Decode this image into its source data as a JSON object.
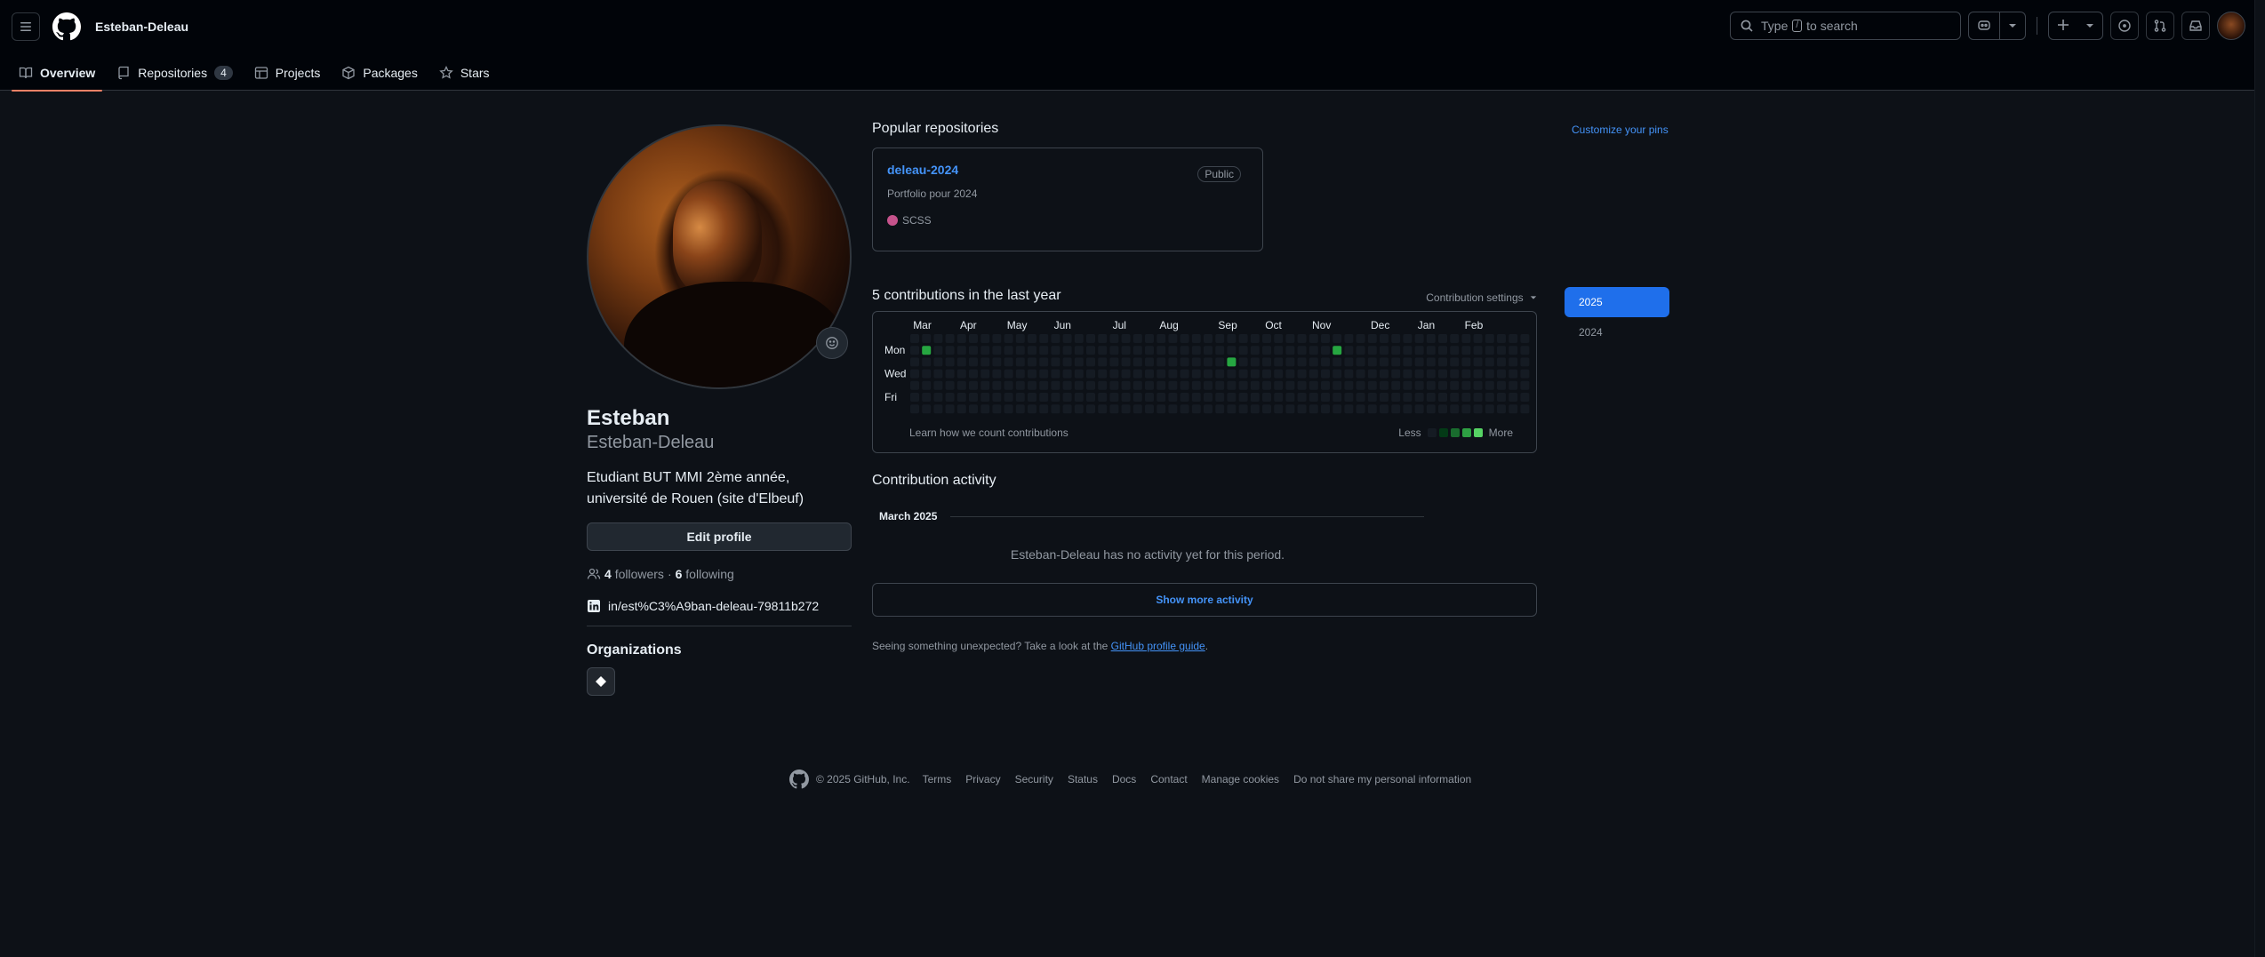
{
  "header": {
    "owner": "Esteban-Deleau",
    "search_prefix": "Type",
    "search_key": "/",
    "search_suffix": "to search"
  },
  "tabs": [
    {
      "label": "Overview",
      "count": ""
    },
    {
      "label": "Repositories",
      "count": "4"
    },
    {
      "label": "Projects",
      "count": ""
    },
    {
      "label": "Packages",
      "count": ""
    },
    {
      "label": "Stars",
      "count": ""
    }
  ],
  "profile": {
    "name": "Esteban",
    "login": "Esteban-Deleau",
    "bio": "Etudiant BUT MMI 2ème année, université de Rouen (site d'Elbeuf)",
    "edit_label": "Edit profile",
    "followers_count": "4",
    "followers_label": "followers",
    "dot": "·",
    "following_count": "6",
    "following_label": "following",
    "linkedin": "in/est%C3%A9ban-deleau-79811b272",
    "orgs_title": "Organizations"
  },
  "popular": {
    "title": "Popular repositories",
    "customize": "Customize your pins",
    "repo": {
      "name": "deleau-2024",
      "visibility": "Public",
      "description": "Portfolio pour 2024",
      "language": "SCSS",
      "language_color": "#c6538c"
    }
  },
  "contributions": {
    "title": "5 contributions in the last year",
    "settings_label": "Contribution settings",
    "months": [
      "Mar",
      "Apr",
      "May",
      "Jun",
      "Jul",
      "Aug",
      "Sep",
      "Oct",
      "Nov",
      "Dec",
      "Jan",
      "Feb"
    ],
    "day_labels": [
      "Mon",
      "Wed",
      "Fri"
    ],
    "learn_label": "Learn how we count contributions",
    "less_label": "Less",
    "more_label": "More",
    "empty_color": "#151b23",
    "active_color": "#26a641",
    "legend_colors": [
      "#151b23",
      "#033a16",
      "#196c2e",
      "#2ea043",
      "#56d364"
    ],
    "active_cells": [
      {
        "week": 1,
        "day": 1
      },
      {
        "week": 27,
        "day": 2
      },
      {
        "week": 36,
        "day": 1
      }
    ]
  },
  "activity": {
    "title": "Contribution activity",
    "month": "March 2025",
    "empty_text": "Esteban-Deleau has no activity yet for this period.",
    "more_label": "Show more activity",
    "unexpected_text": "Seeing something unexpected? Take a look at the",
    "guide_link": "GitHub profile guide",
    "guide_suffix": "."
  },
  "years": [
    "2025",
    "2024"
  ],
  "footer": {
    "copyright": "© 2025 GitHub, Inc.",
    "links": [
      "Terms",
      "Privacy",
      "Security",
      "Status",
      "Docs",
      "Contact",
      "Manage cookies",
      "Do not share my personal information"
    ]
  }
}
